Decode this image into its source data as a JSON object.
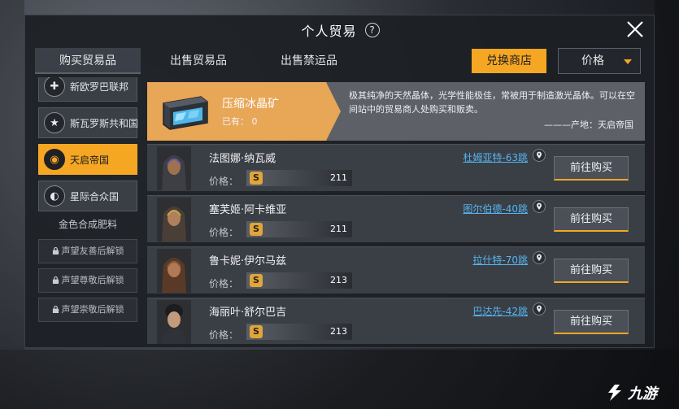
{
  "window": {
    "title": "个人贸易",
    "help_glyph": "?"
  },
  "tabs": [
    {
      "label": "购买贸易品",
      "active": true
    },
    {
      "label": "出售贸易品",
      "active": false
    },
    {
      "label": "出售禁运品",
      "active": false
    }
  ],
  "exchange_button": "兑换商店",
  "sort": {
    "selected": "价格"
  },
  "sidebar": {
    "factions": [
      {
        "label": "新欧罗巴联邦",
        "icon": "cross-icon",
        "glyph": "✚",
        "active": false
      },
      {
        "label": "斯瓦罗斯共和国",
        "icon": "star-icon",
        "glyph": "★",
        "active": false
      },
      {
        "label": "天启帝国",
        "icon": "empire-icon",
        "glyph": "◉",
        "active": true
      },
      {
        "label": "星际合众国",
        "icon": "union-icon",
        "glyph": "◐",
        "active": false
      }
    ],
    "sub_label": "金色合成肥料",
    "locked": [
      "声望友善后解锁",
      "声望尊敬后解锁",
      "声望崇敬后解锁"
    ]
  },
  "item": {
    "name": "压缩冰晶矿",
    "owned": "已有： 0",
    "description": "极其纯净的天然晶体，光学性能极佳，常被用于制造激光晶体。可以在空间站中的贸易商人处购买和贩卖。",
    "origin": "———产地：天启帝国"
  },
  "price_label": "价格：",
  "coin_glyph": "S",
  "go_label": "前往购买",
  "traders": [
    {
      "name": "法图娜·纳瓦威",
      "price": "211",
      "location": "杜姆亚特-63跳"
    },
    {
      "name": "塞芙姬·阿卡维亚",
      "price": "211",
      "location": "图尔伯德-40跳"
    },
    {
      "name": "鲁卡妮·伊尔马兹",
      "price": "213",
      "location": "拉什特-70跳"
    },
    {
      "name": "海丽叶·舒尔巴吉",
      "price": "213",
      "location": "巴达先-42跳"
    }
  ],
  "watermark": "九游",
  "colors": {
    "accent": "#f5a623",
    "link": "#55b5f0",
    "panel": "#1c1f24"
  }
}
